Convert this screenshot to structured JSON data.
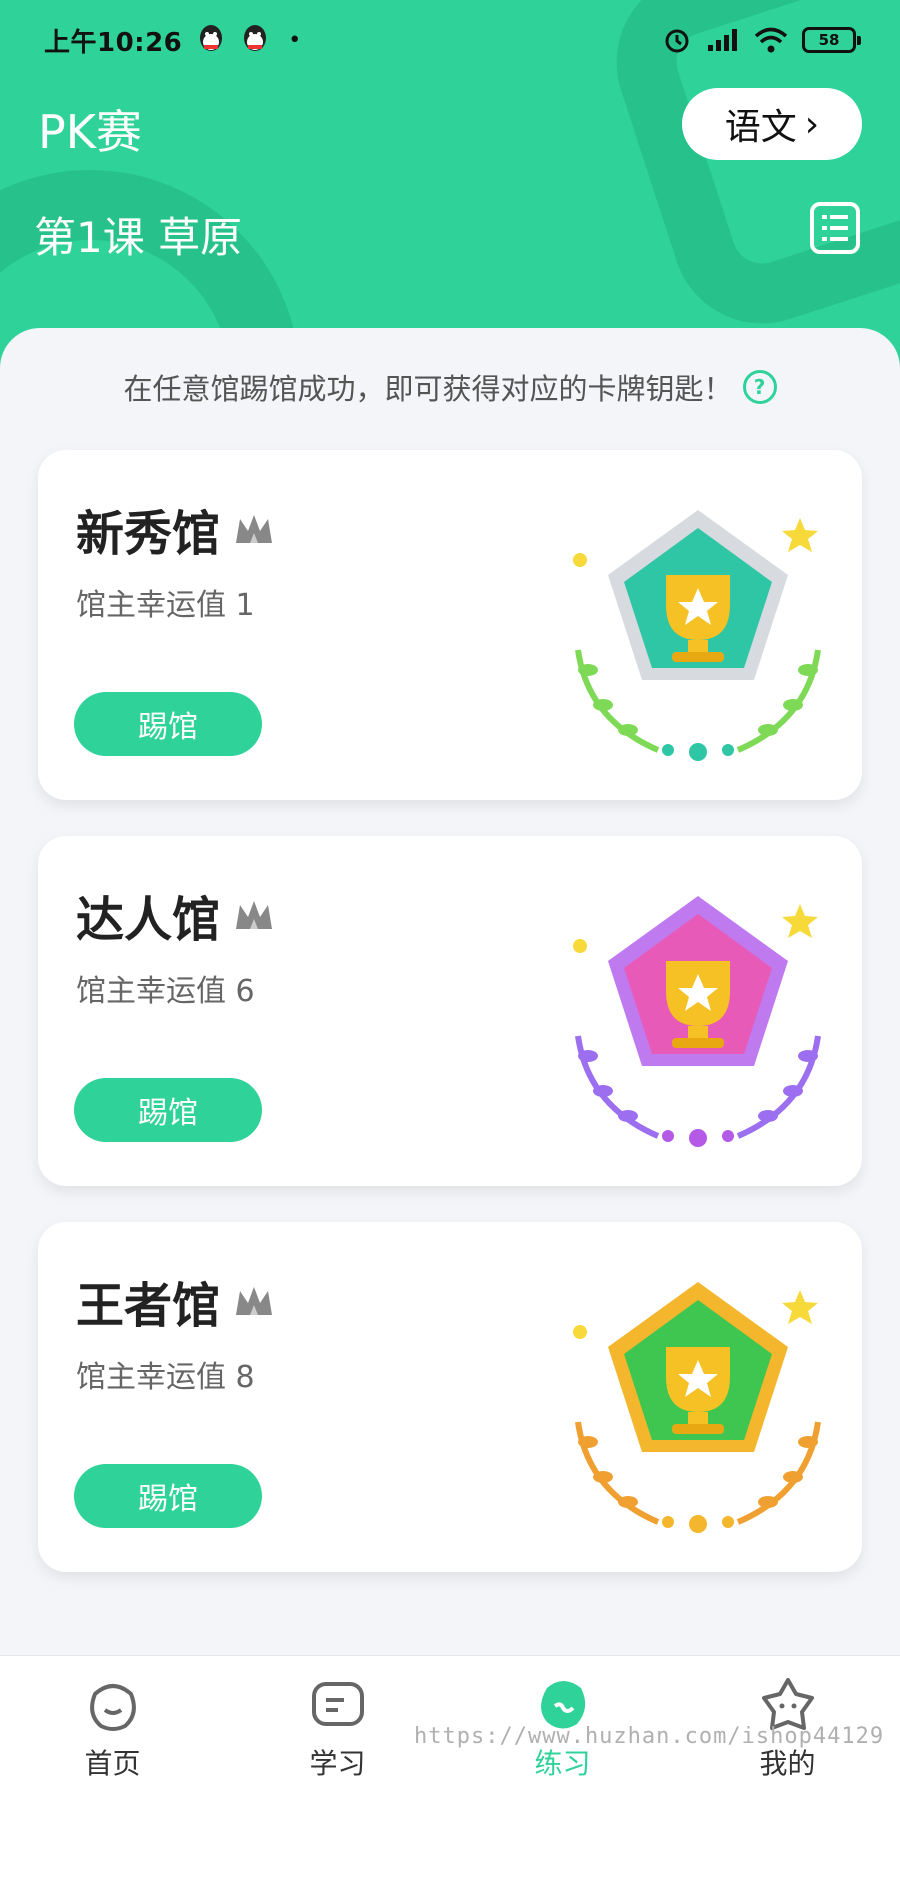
{
  "status_bar": {
    "time": "上午10:26",
    "dot": "•",
    "battery": "58"
  },
  "header": {
    "title": "PK赛",
    "subject": "语文",
    "subject_chevron": "›",
    "lesson": "第1课 草原"
  },
  "notice": {
    "text": "在任意馆踢馆成功，即可获得对应的卡牌钥匙！",
    "help_glyph": "?"
  },
  "halls": [
    {
      "name": "新秀馆",
      "desc": "馆主幸运值 1",
      "button": "踢馆",
      "theme": "#2fc6a6"
    },
    {
      "name": "达人馆",
      "desc": "馆主幸运值 6",
      "button": "踢馆",
      "theme": "#b45ae6"
    },
    {
      "name": "王者馆",
      "desc": "馆主幸运值 8",
      "button": "踢馆",
      "theme": "#f4b62c"
    }
  ],
  "tabs": [
    {
      "label": "首页",
      "icon": "smile-face-icon"
    },
    {
      "label": "学习",
      "icon": "book-card-icon"
    },
    {
      "label": "练习",
      "icon": "practice-blob-icon",
      "active": true
    },
    {
      "label": "我的",
      "icon": "star-face-icon"
    }
  ],
  "watermark": "https://www.huzhan.com/ishop44129",
  "colors": {
    "accent": "#2fd39a",
    "background": "#f3f5f8"
  }
}
